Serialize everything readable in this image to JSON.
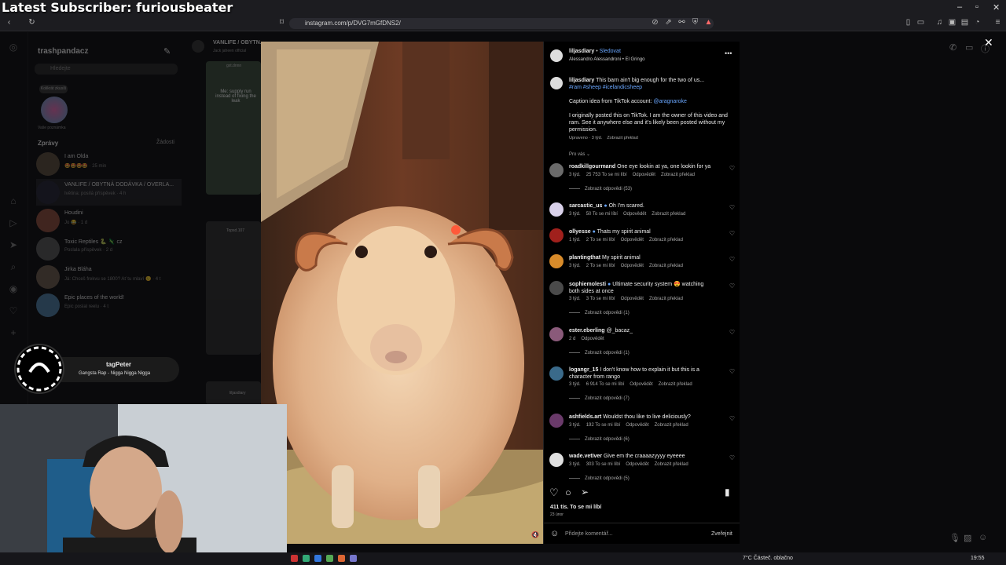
{
  "overlay": {
    "subscriber_text": "Latest Subscriber: furiousbeater"
  },
  "browser": {
    "url": "instagram.com/p/DVG7mGfDNS2/",
    "window_controls": [
      "–",
      "▫",
      "✕"
    ]
  },
  "dm_panel": {
    "username": "trashpandacz",
    "search_placeholder": "Hledejte",
    "note_bubble": "Kolikrát zkusíš",
    "note_caption": "Vaše poznámka",
    "section_title": "Zprávy",
    "requests_link": "Žádosti",
    "chats": [
      {
        "name": "I am Olda",
        "sub": "🤩🤩🤩🤩 · 25 min"
      },
      {
        "name": "VANLIFE / OBYTNÁ DODÁVKA / OVERLA...",
        "sub": "Ivětina: posílá příspěvek · 4 h"
      },
      {
        "name": "Houdini",
        "sub": "Jo 😂 · 1 d"
      },
      {
        "name": "Toxic Reptiles 🐍 🦎 cz",
        "sub": "Poslala příspěvek · 2 d"
      },
      {
        "name": "Jirka Bláha",
        "sub": "Já: Chceš frekvu se 1800? Ať tu mlaví 🙂 · 4 t"
      },
      {
        "name": "Epic places of the world!",
        "sub": "Epic poslal reelu · 4 t"
      }
    ]
  },
  "feed": {
    "header_title": "VANLIFE / OBYTN...",
    "header_sub": "Jack jaheen official",
    "card1_user": "gxt.dnnn",
    "card1_text": "Me: supply run instead of fixing the leak",
    "card2_user": "Topsd.107",
    "card3_user": "liljasdiary"
  },
  "now_playing": {
    "title": "tagPeter",
    "subtitle": "Gangsta Rap - Nigga Nigga Nigga"
  },
  "post": {
    "author": "liljasdiary",
    "follow_label": "Sledovat",
    "audio": "Alessandro Alessandroni • El Gringo",
    "caption_user": "liljasdiary",
    "caption_text": "This barn ain't big enough for the two of us...",
    "hashtags": "#ram #sheep #icelandicsheep",
    "caption_idea_prefix": "Caption idea from TikTok account:",
    "caption_idea_handle": "@aragnaroke",
    "caption_note": "I originally posted this on TikTok. I am the owner of this video and ram. See it anywhere else and it's likely been posted without my permission.",
    "caption_meta": "Upraveno · 3 týd.",
    "caption_translate": "Zobrazit překlad",
    "sort_label": "Pro vás",
    "likes": "411 tis. To se mi líbí",
    "date": "23 únor",
    "comment_placeholder": "Přidejte komentář...",
    "publish_label": "Zveřejnit"
  },
  "comments": [
    {
      "user": "roadkillgourmand",
      "text": "One eye lookin at ya, one lookin for ya",
      "verified": false,
      "time": "3 týd.",
      "likes": "25 753 To se mi líbí",
      "reply": "Odpovědět",
      "translate": "Zobrazit překlad",
      "replies": "Zobrazit odpovědi (53)",
      "avatar": "#6b6b6b"
    },
    {
      "user": "sarcastic_us",
      "text": "Oh I'm scared.",
      "verified": true,
      "time": "3 týd.",
      "likes": "50 To se mi líbí",
      "reply": "Odpovědět",
      "translate": "Zobrazit překlad",
      "replies": "",
      "avatar": "#d9d1ea"
    },
    {
      "user": "ollyesse",
      "text": "Thats my spirit animal",
      "verified": true,
      "time": "1 týd.",
      "likes": "2 To se mi líbí",
      "reply": "Odpovědět",
      "translate": "Zobrazit překlad",
      "replies": "",
      "avatar": "#a0201c"
    },
    {
      "user": "plantingthat",
      "text": "My spirit animal",
      "verified": false,
      "time": "3 týd.",
      "likes": "2 To se mi líbí",
      "reply": "Odpovědět",
      "translate": "Zobrazit překlad",
      "replies": "",
      "avatar": "#d88b2a"
    },
    {
      "user": "sophiemolesti",
      "text": "Ultimate security system 😍 watching both sides at once",
      "verified": true,
      "time": "3 týd.",
      "likes": "3 To se mi líbí",
      "reply": "Odpovědět",
      "translate": "Zobrazit překlad",
      "replies": "Zobrazit odpovědi (1)",
      "avatar": "#4a4a4a"
    },
    {
      "user": "ester.eberling",
      "text": "@_bacaz_",
      "verified": false,
      "time": "2 d",
      "likes": "",
      "reply": "Odpovědět",
      "translate": "",
      "replies": "Zobrazit odpovědi (1)",
      "avatar": "#8a5a7a"
    },
    {
      "user": "logangr_15",
      "text": "I don't know how to explain it but this is a character from rango",
      "verified": false,
      "time": "3 týd.",
      "likes": "6 914 To se mi líbí",
      "reply": "Odpovědět",
      "translate": "Zobrazit překlad",
      "replies": "Zobrazit odpovědi (7)",
      "avatar": "#3a6a8a"
    },
    {
      "user": "ashfields.art",
      "text": "Wouldst thou like to live deliciously?",
      "verified": false,
      "time": "3 týd.",
      "likes": "192 To se mi líbí",
      "reply": "Odpovědět",
      "translate": "Zobrazit překlad",
      "replies": "Zobrazit odpovědi (6)",
      "avatar": "#6a3a6a"
    },
    {
      "user": "wade.vetiver",
      "text": "Give em the craaaazyyyy eyeeee",
      "verified": false,
      "time": "3 týd.",
      "likes": "303 To se mi líbí",
      "reply": "Odpovědět",
      "translate": "Zobrazit překlad",
      "replies": "Zobrazit odpovědi (5)",
      "avatar": "#e0e0e0"
    }
  ],
  "taskbar": {
    "weather": "7°C Částeč. oblačno",
    "time": "19:55"
  },
  "colors": {
    "link": "#6aa7ff",
    "background": "#000000",
    "follow": "#6aa7ff"
  }
}
